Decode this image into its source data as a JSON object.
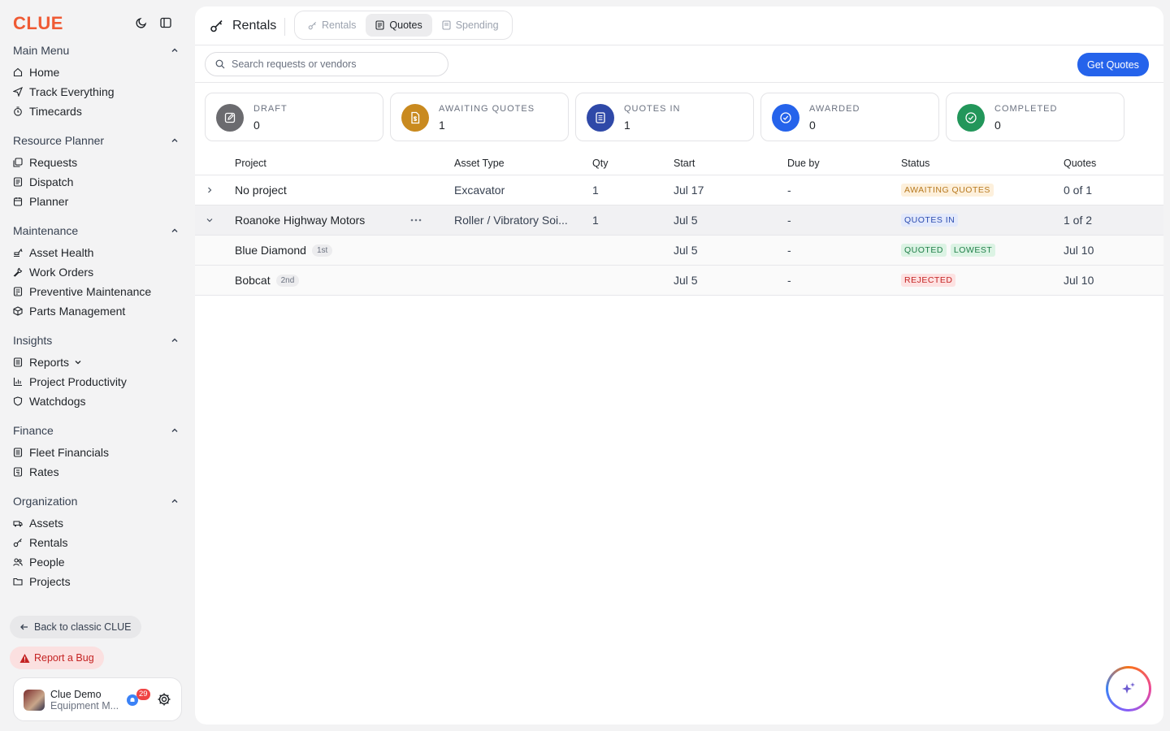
{
  "app": {
    "logo": "CLUE"
  },
  "sidebar": {
    "sections": [
      {
        "title": "Main Menu",
        "items": [
          {
            "label": "Home",
            "icon": "home-icon"
          },
          {
            "label": "Track Everything",
            "icon": "send-icon"
          },
          {
            "label": "Timecards",
            "icon": "timer-icon"
          }
        ]
      },
      {
        "title": "Resource Planner",
        "items": [
          {
            "label": "Requests",
            "icon": "copy-icon"
          },
          {
            "label": "Dispatch",
            "icon": "list-icon"
          },
          {
            "label": "Planner",
            "icon": "calendar-icon"
          }
        ]
      },
      {
        "title": "Maintenance",
        "items": [
          {
            "label": "Asset Health",
            "icon": "excavator-icon"
          },
          {
            "label": "Work Orders",
            "icon": "wrench-icon"
          },
          {
            "label": "Preventive Maintenance",
            "icon": "checklist-icon"
          },
          {
            "label": "Parts Management",
            "icon": "box-icon"
          }
        ]
      },
      {
        "title": "Insights",
        "items": [
          {
            "label": "Reports",
            "icon": "report-icon"
          },
          {
            "label": "Project Productivity",
            "icon": "bar-chart-icon"
          },
          {
            "label": "Watchdogs",
            "icon": "shield-icon"
          }
        ]
      },
      {
        "title": "Finance",
        "items": [
          {
            "label": "Fleet Financials",
            "icon": "doc-icon"
          },
          {
            "label": "Rates",
            "icon": "receipt-icon"
          }
        ]
      },
      {
        "title": "Organization",
        "items": [
          {
            "label": "Assets",
            "icon": "truck-icon"
          },
          {
            "label": "Rentals",
            "icon": "key-icon"
          },
          {
            "label": "People",
            "icon": "users-icon"
          },
          {
            "label": "Projects",
            "icon": "folder-icon"
          }
        ]
      }
    ],
    "back_label": "Back to classic CLUE",
    "bug_label": "Report a Bug",
    "user": {
      "name": "Clue Demo",
      "role": "Equipment M...",
      "notifications": "29"
    }
  },
  "header": {
    "title": "Rentals",
    "tabs": [
      {
        "label": "Rentals",
        "active": false
      },
      {
        "label": "Quotes",
        "active": true
      },
      {
        "label": "Spending",
        "active": false
      }
    ]
  },
  "toolbar": {
    "search_placeholder": "Search requests or vendors",
    "primary_label": "Get Quotes"
  },
  "stats": [
    {
      "label": "DRAFT",
      "value": "0",
      "color": "#6b6b6f",
      "icon": "edit-icon"
    },
    {
      "label": "AWAITING QUOTES",
      "value": "1",
      "color": "#c98a1f",
      "icon": "file-dollar-icon"
    },
    {
      "label": "QUOTES IN",
      "value": "1",
      "color": "#2f49a8",
      "icon": "clipboard-icon"
    },
    {
      "label": "AWARDED",
      "value": "0",
      "color": "#2563eb",
      "icon": "check-badge-icon"
    },
    {
      "label": "COMPLETED",
      "value": "0",
      "color": "#22965a",
      "icon": "check-circle-icon"
    }
  ],
  "table": {
    "columns": {
      "project": "Project",
      "asset": "Asset Type",
      "qty": "Qty",
      "start": "Start",
      "due": "Due by",
      "status": "Status",
      "quotes": "Quotes"
    },
    "rows": [
      {
        "project": "No project",
        "asset": "Excavator",
        "qty": "1",
        "start": "Jul 17",
        "due": "-",
        "status": "AWAITING QUOTES",
        "quotes": "0 of 1"
      },
      {
        "project": "Roanoke Highway Motors",
        "asset": "Roller / Vibratory Soi...",
        "qty": "1",
        "start": "Jul 5",
        "due": "-",
        "status": "QUOTES IN",
        "quotes": "1 of 2"
      }
    ],
    "children": [
      {
        "vendor": "Blue Diamond",
        "rank": "1st",
        "start": "Jul 5",
        "due": "-",
        "status": "QUOTED",
        "status2": "LOWEST",
        "quotes": "Jul 10"
      },
      {
        "vendor": "Bobcat",
        "rank": "2nd",
        "start": "Jul 5",
        "due": "-",
        "status": "REJECTED",
        "quotes": "Jul 10"
      }
    ]
  }
}
